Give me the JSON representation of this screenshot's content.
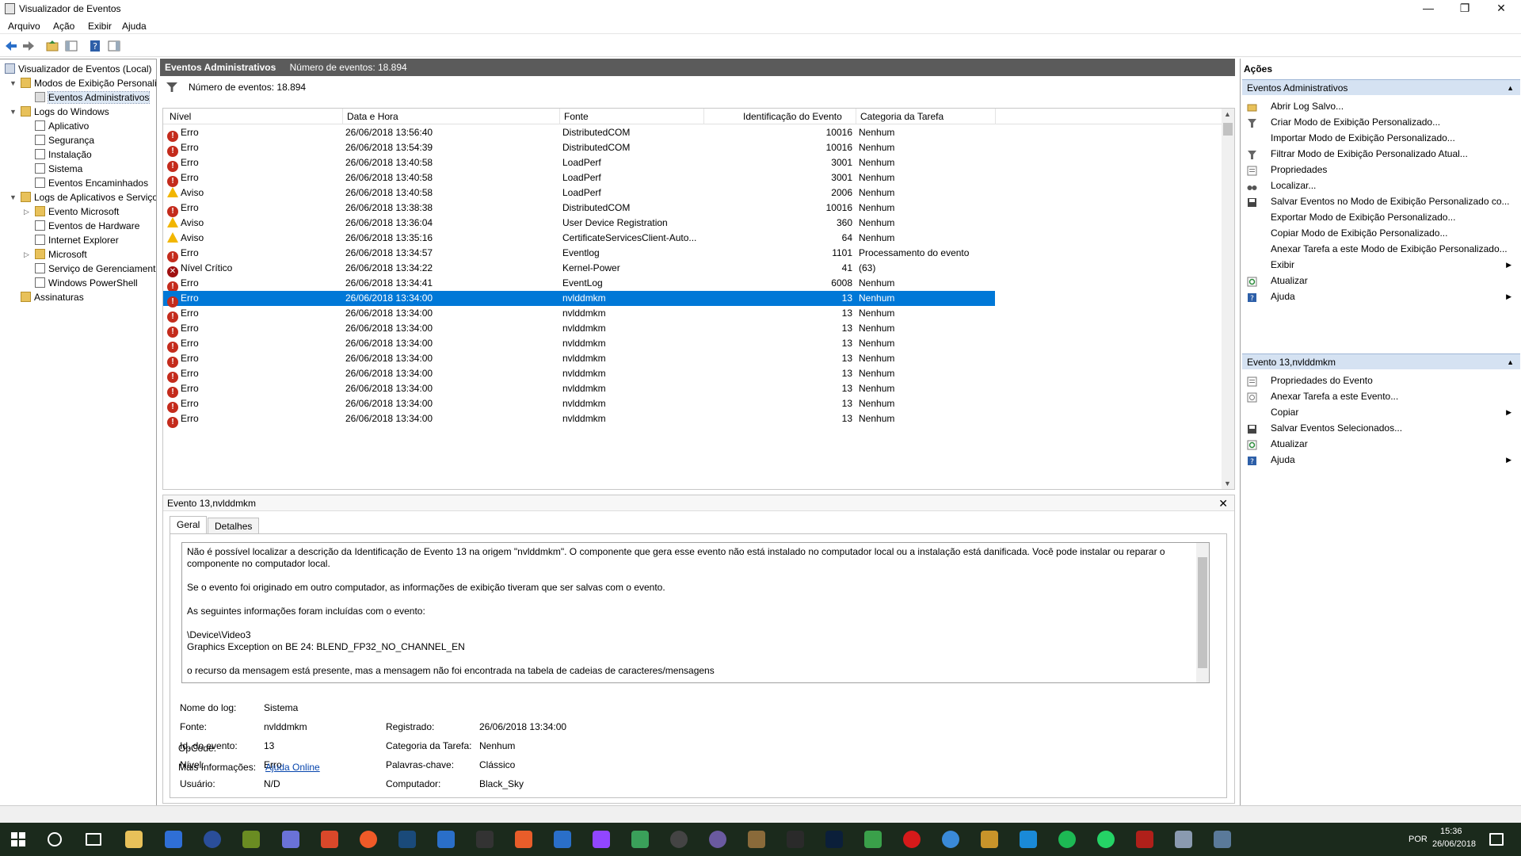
{
  "window": {
    "title": "Visualizador de Eventos",
    "minimize": "—",
    "maximize": "❐",
    "close": "✕"
  },
  "menu": [
    "Arquivo",
    "Ação",
    "Exibir",
    "Ajuda"
  ],
  "tree": {
    "items": [
      {
        "label": "Visualizador de Eventos (Local)",
        "icon": "computer-icon"
      },
      {
        "label": "Modos de Exibição Personali",
        "icon": "folder-icon"
      },
      {
        "label": "Eventos Administrativos",
        "icon": "filter-icon"
      },
      {
        "label": "Logs do Windows",
        "icon": "folder-icon"
      },
      {
        "label": "Aplicativo",
        "icon": "log-icon"
      },
      {
        "label": "Segurança",
        "icon": "log-icon"
      },
      {
        "label": "Instalação",
        "icon": "log-icon"
      },
      {
        "label": "Sistema",
        "icon": "log-icon"
      },
      {
        "label": "Eventos Encaminhados",
        "icon": "log-icon"
      },
      {
        "label": "Logs de Aplicativos e Serviço",
        "icon": "folder-icon"
      },
      {
        "label": "Evento Microsoft",
        "icon": "folder-icon"
      },
      {
        "label": "Eventos de Hardware",
        "icon": "log-icon"
      },
      {
        "label": "Internet Explorer",
        "icon": "log-icon"
      },
      {
        "label": "Microsoft",
        "icon": "folder-icon"
      },
      {
        "label": "Serviço de Gerenciament",
        "icon": "log-icon"
      },
      {
        "label": "Windows PowerShell",
        "icon": "log-icon"
      },
      {
        "label": "Assinaturas",
        "icon": "folder-icon"
      }
    ]
  },
  "center": {
    "title": "Eventos Administrativos",
    "count": "Número de eventos: 18.894",
    "filter_count": "Número de eventos: 18.894",
    "columns": [
      "Nível",
      "Data e Hora",
      "Fonte",
      "Identificação do Evento",
      "Categoria da Tarefa"
    ],
    "rows": [
      {
        "level": "Erro",
        "type": "err",
        "date": "26/06/2018 13:56:40",
        "source": "DistributedCOM",
        "id": "10016",
        "cat": "Nenhum"
      },
      {
        "level": "Erro",
        "type": "err",
        "date": "26/06/2018 13:54:39",
        "source": "DistributedCOM",
        "id": "10016",
        "cat": "Nenhum"
      },
      {
        "level": "Erro",
        "type": "err",
        "date": "26/06/2018 13:40:58",
        "source": "LoadPerf",
        "id": "3001",
        "cat": "Nenhum"
      },
      {
        "level": "Erro",
        "type": "err",
        "date": "26/06/2018 13:40:58",
        "source": "LoadPerf",
        "id": "3001",
        "cat": "Nenhum"
      },
      {
        "level": "Aviso",
        "type": "warn",
        "date": "26/06/2018 13:40:58",
        "source": "LoadPerf",
        "id": "2006",
        "cat": "Nenhum"
      },
      {
        "level": "Erro",
        "type": "err",
        "date": "26/06/2018 13:38:38",
        "source": "DistributedCOM",
        "id": "10016",
        "cat": "Nenhum"
      },
      {
        "level": "Aviso",
        "type": "warn",
        "date": "26/06/2018 13:36:04",
        "source": "User Device Registration",
        "id": "360",
        "cat": "Nenhum"
      },
      {
        "level": "Aviso",
        "type": "warn",
        "date": "26/06/2018 13:35:16",
        "source": "CertificateServicesClient-Auto...",
        "id": "64",
        "cat": "Nenhum"
      },
      {
        "level": "Erro",
        "type": "err",
        "date": "26/06/2018 13:34:57",
        "source": "Eventlog",
        "id": "1101",
        "cat": "Processamento do evento"
      },
      {
        "level": "Nível Crítico",
        "type": "crit",
        "date": "26/06/2018 13:34:22",
        "source": "Kernel-Power",
        "id": "41",
        "cat": "(63)"
      },
      {
        "level": "Erro",
        "type": "err",
        "date": "26/06/2018 13:34:41",
        "source": "EventLog",
        "id": "6008",
        "cat": "Nenhum"
      },
      {
        "level": "Erro",
        "type": "err",
        "date": "26/06/2018 13:34:00",
        "source": "nvlddmkm",
        "id": "13",
        "cat": "Nenhum",
        "selected": true
      },
      {
        "level": "Erro",
        "type": "err",
        "date": "26/06/2018 13:34:00",
        "source": "nvlddmkm",
        "id": "13",
        "cat": "Nenhum"
      },
      {
        "level": "Erro",
        "type": "err",
        "date": "26/06/2018 13:34:00",
        "source": "nvlddmkm",
        "id": "13",
        "cat": "Nenhum"
      },
      {
        "level": "Erro",
        "type": "err",
        "date": "26/06/2018 13:34:00",
        "source": "nvlddmkm",
        "id": "13",
        "cat": "Nenhum"
      },
      {
        "level": "Erro",
        "type": "err",
        "date": "26/06/2018 13:34:00",
        "source": "nvlddmkm",
        "id": "13",
        "cat": "Nenhum"
      },
      {
        "level": "Erro",
        "type": "err",
        "date": "26/06/2018 13:34:00",
        "source": "nvlddmkm",
        "id": "13",
        "cat": "Nenhum"
      },
      {
        "level": "Erro",
        "type": "err",
        "date": "26/06/2018 13:34:00",
        "source": "nvlddmkm",
        "id": "13",
        "cat": "Nenhum"
      },
      {
        "level": "Erro",
        "type": "err",
        "date": "26/06/2018 13:34:00",
        "source": "nvlddmkm",
        "id": "13",
        "cat": "Nenhum"
      },
      {
        "level": "Erro",
        "type": "err",
        "date": "26/06/2018 13:34:00",
        "source": "nvlddmkm",
        "id": "13",
        "cat": "Nenhum"
      }
    ]
  },
  "detail": {
    "title": "Evento 13,nvlddmkm",
    "tabs": [
      "Geral",
      "Detalhes"
    ],
    "description": [
      "Não é possível localizar a descrição da Identificação de Evento 13 na origem \"nvlddmkm\". O componente que gera esse evento não está instalado no computador local ou a instalação está danificada. Você pode instalar ou reparar o componente no computador local.",
      "Se o evento foi originado em outro computador, as informações de exibição tiveram que ser salvas com o evento.",
      "As seguintes informações foram incluídas com o evento:",
      "\\Device\\Video3",
      "Graphics Exception on BE 24: BLEND_FP32_NO_CHANNEL_EN",
      "o recurso da mensagem está presente, mas a mensagem não foi encontrada na tabela de cadeias de caracteres/mensagens"
    ],
    "fields": {
      "log_name_label": "Nome do log:",
      "log_name": "Sistema",
      "source_label": "Fonte:",
      "source": "nvlddmkm",
      "logged_label": "Registrado:",
      "logged": "26/06/2018 13:34:00",
      "event_id_label": "Id. do evento:",
      "event_id": "13",
      "task_cat_label": "Categoria da Tarefa:",
      "task_cat": "Nenhum",
      "level_label": "Nível:",
      "level": "Erro",
      "keywords_label": "Palavras-chave:",
      "keywords": "Clássico",
      "user_label": "Usuário:",
      "user": "N/D",
      "computer_label": "Computador:",
      "computer": "Black_Sky",
      "opcode_label": "OpCode:",
      "more_info_label": "Mais Informações:",
      "more_info_link": "Ajuda Online"
    }
  },
  "actions": {
    "title": "Ações",
    "section1": "Eventos Administrativos",
    "items1": [
      {
        "label": "Abrir Log Salvo...",
        "icon": "folder-open-icon"
      },
      {
        "label": "Criar Modo de Exibição Personalizado...",
        "icon": "filter-icon"
      },
      {
        "label": "Importar Modo de Exibição Personalizado...",
        "icon": ""
      },
      {
        "label": "Filtrar Modo de Exibição Personalizado Atual...",
        "icon": "filter-icon"
      },
      {
        "label": "Propriedades",
        "icon": "properties-icon"
      },
      {
        "label": "Localizar...",
        "icon": "binoculars-icon"
      },
      {
        "label": "Salvar Eventos no Modo de Exibição Personalizado co...",
        "icon": "save-icon"
      },
      {
        "label": "Exportar Modo de Exibição Personalizado...",
        "icon": ""
      },
      {
        "label": "Copiar Modo de Exibição Personalizado...",
        "icon": ""
      },
      {
        "label": "Anexar Tarefa a este Modo de Exibição Personalizado...",
        "icon": ""
      },
      {
        "label": "Exibir",
        "icon": "",
        "submenu": true
      },
      {
        "label": "Atualizar",
        "icon": "refresh-icon"
      },
      {
        "label": "Ajuda",
        "icon": "help-icon",
        "submenu": true
      }
    ],
    "section2": "Evento 13,nvlddmkm",
    "items2": [
      {
        "label": "Propriedades do Evento",
        "icon": "properties-icon"
      },
      {
        "label": "Anexar Tarefa a este Evento...",
        "icon": "task-icon"
      },
      {
        "label": "Copiar",
        "icon": "copy-icon",
        "submenu": true
      },
      {
        "label": "Salvar Eventos Selecionados...",
        "icon": "save-icon"
      },
      {
        "label": "Atualizar",
        "icon": "refresh-icon"
      },
      {
        "label": "Ajuda",
        "icon": "help-icon",
        "submenu": true
      }
    ]
  },
  "taskbar": {
    "language": "POR",
    "time": "15:36",
    "date": "26/06/2018"
  }
}
